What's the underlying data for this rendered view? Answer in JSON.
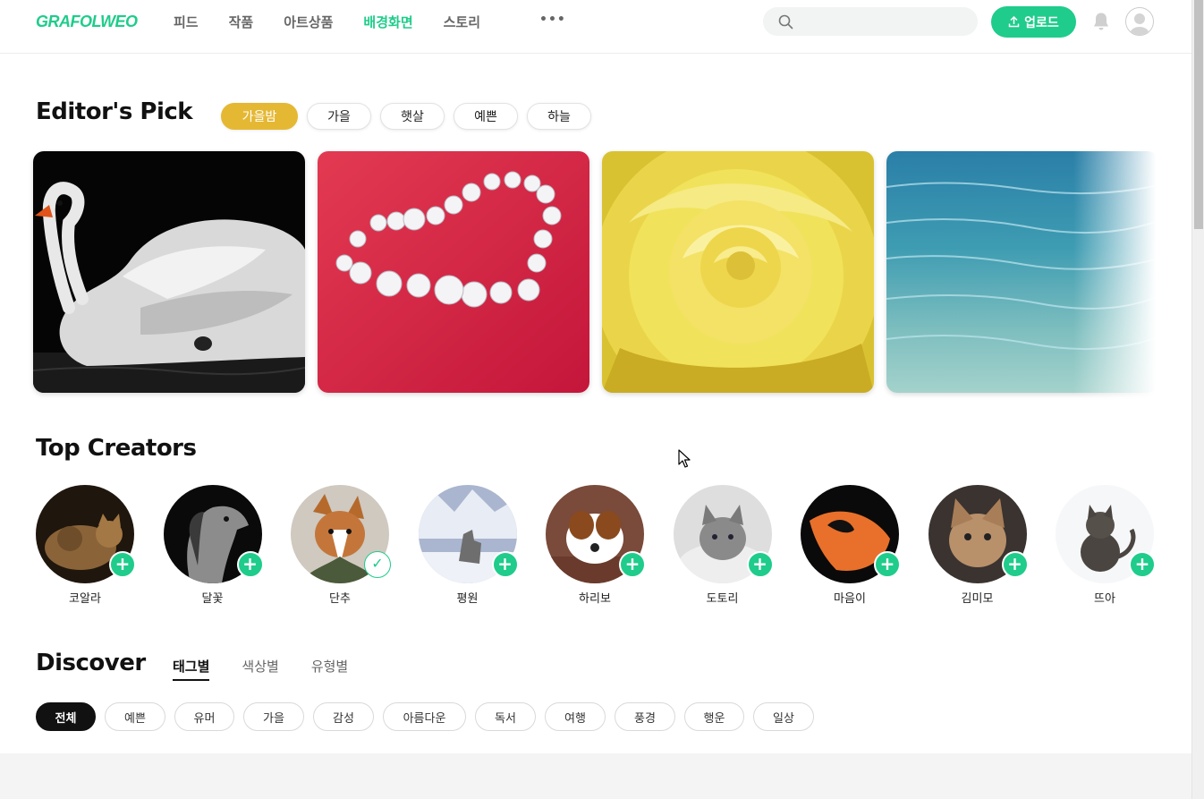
{
  "header": {
    "logo": "GRAFOLWEO",
    "nav": [
      "피드",
      "작품",
      "아트상품",
      "배경화면",
      "스토리"
    ],
    "active_nav": "배경화면",
    "more": "•••",
    "search_placeholder": "",
    "upload_label": "업로드",
    "accent_color": "#1fcc8b"
  },
  "editors_pick": {
    "title": "Editor's Pick",
    "chips": [
      "가을밤",
      "가을",
      "햇살",
      "예쁜",
      "하늘"
    ],
    "active_chip": "가을밤",
    "cards": [
      "swan-photo",
      "diamond-heart-photo",
      "yellow-rose-photo",
      "sea-water-photo"
    ]
  },
  "top_creators": {
    "title": "Top Creators",
    "creators": [
      {
        "name": "코알라",
        "following": false
      },
      {
        "name": "달꽃",
        "following": false
      },
      {
        "name": "단추",
        "following": true
      },
      {
        "name": "평원",
        "following": false
      },
      {
        "name": "하리보",
        "following": false
      },
      {
        "name": "도토리",
        "following": false
      },
      {
        "name": "마음이",
        "following": false
      },
      {
        "name": "김미모",
        "following": false
      },
      {
        "name": "뜨아",
        "following": false
      }
    ]
  },
  "discover": {
    "title": "Discover",
    "tabs": [
      "태그별",
      "색상별",
      "유형별"
    ],
    "active_tab": "태그별",
    "tags": [
      "전체",
      "예쁜",
      "유머",
      "가을",
      "감성",
      "아름다운",
      "독서",
      "여행",
      "풍경",
      "행운",
      "일상"
    ],
    "active_tag": "전체"
  }
}
